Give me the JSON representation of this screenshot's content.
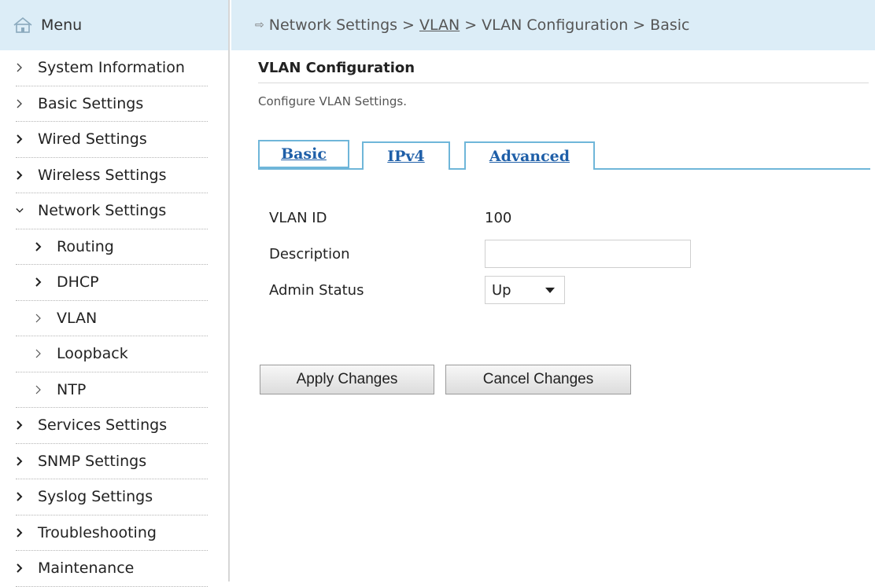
{
  "menu": {
    "title": "Menu",
    "items": [
      {
        "label": "System Information",
        "sub": false
      },
      {
        "label": "Basic Settings",
        "sub": false
      },
      {
        "label": "Wired Settings",
        "sub": false
      },
      {
        "label": "Wireless Settings",
        "sub": false
      },
      {
        "label": "Network Settings",
        "sub": false,
        "expanded": true
      },
      {
        "label": "Routing",
        "sub": true
      },
      {
        "label": "DHCP",
        "sub": true
      },
      {
        "label": "VLAN",
        "sub": true,
        "selected": true
      },
      {
        "label": "Loopback",
        "sub": true
      },
      {
        "label": "NTP",
        "sub": true
      },
      {
        "label": "Services Settings",
        "sub": false
      },
      {
        "label": "SNMP Settings",
        "sub": false
      },
      {
        "label": "Syslog Settings",
        "sub": false
      },
      {
        "label": "Troubleshooting",
        "sub": false
      },
      {
        "label": "Maintenance",
        "sub": false
      }
    ]
  },
  "breadcrumb": {
    "arrow": "⇨",
    "sep": ">",
    "parts": [
      "Network Settings",
      "VLAN",
      "VLAN Configuration",
      "Basic"
    ]
  },
  "page": {
    "title": "VLAN Configuration",
    "description": "Configure VLAN Settings."
  },
  "tabs": [
    {
      "label": "Basic",
      "active": true
    },
    {
      "label": "IPv4",
      "active": false
    },
    {
      "label": "Advanced",
      "active": false
    }
  ],
  "form": {
    "vlan_id_label": "VLAN ID",
    "vlan_id_value": "100",
    "description_label": "Description",
    "description_value": "",
    "admin_status_label": "Admin Status",
    "admin_status_value": "Up"
  },
  "buttons": {
    "apply": "Apply Changes",
    "cancel": "Cancel Changes"
  },
  "colors": {
    "header_bg": "#dcedf7",
    "tab_border": "#6fb6d9",
    "tab_text": "#1f5fa8"
  }
}
